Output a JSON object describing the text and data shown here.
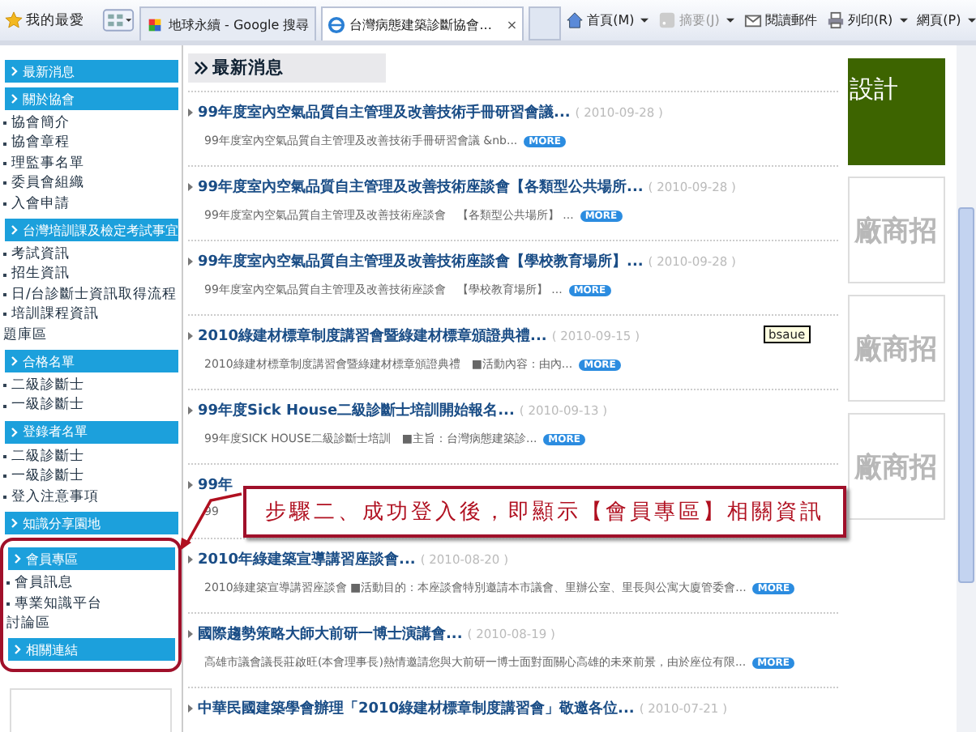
{
  "browser": {
    "favorites": "我的最愛",
    "tabs": [
      {
        "title": "地球永續 - Google 搜尋",
        "kind": "search",
        "selected": false
      },
      {
        "title": "台灣病態建築診斷協會...",
        "kind": "site",
        "selected": true,
        "close": "×"
      }
    ],
    "commands": [
      {
        "label": "首頁(M)",
        "kind": "home",
        "disabled": false,
        "dropdown": true
      },
      {
        "label": "摘要(J)",
        "kind": "feed",
        "disabled": true,
        "dropdown": true
      },
      {
        "label": "閱讀郵件",
        "kind": "mail",
        "disabled": false,
        "dropdown": false
      },
      {
        "label": "列印(R)",
        "kind": "print",
        "disabled": false,
        "dropdown": true
      },
      {
        "label": "網頁(P)",
        "kind": "page",
        "disabled": false,
        "dropdown": true
      }
    ]
  },
  "sidebar": {
    "sections": [
      {
        "heading": "最新消息",
        "highlighted": false
      },
      {
        "heading": "關於協會",
        "highlighted": false,
        "items": [
          {
            "label": "協會簡介",
            "bullet": true
          },
          {
            "label": "協會章程",
            "bullet": true
          },
          {
            "label": "理監事名單",
            "bullet": true
          },
          {
            "label": "委員會組織",
            "bullet": true
          },
          {
            "label": "入會申請",
            "bullet": true
          }
        ]
      },
      {
        "heading": "台灣培訓課及檢定考試事宜",
        "highlighted": false,
        "items": [
          {
            "label": "考試資訊",
            "bullet": true
          },
          {
            "label": "招生資訊",
            "bullet": true
          },
          {
            "label": "日/台診斷士資訊取得流程",
            "bullet": true
          },
          {
            "label": "培訓課程資訊",
            "bullet": true
          },
          {
            "label": "題庫區",
            "bullet": false
          }
        ]
      },
      {
        "heading": "合格名單",
        "highlighted": false,
        "items": [
          {
            "label": "二級診斷士",
            "bullet": true
          },
          {
            "label": "一級診斷士",
            "bullet": true
          }
        ]
      },
      {
        "heading": "登錄者名單",
        "highlighted": false,
        "items": [
          {
            "label": "二級診斷士",
            "bullet": true
          },
          {
            "label": "一級診斷士",
            "bullet": true
          },
          {
            "label": "登入注意事項",
            "bullet": true
          }
        ]
      },
      {
        "heading": "知識分享園地",
        "highlighted": false
      },
      {
        "heading": "會員專區",
        "highlighted": true,
        "items": [
          {
            "label": "會員訊息",
            "bullet": true
          },
          {
            "label": "專業知識平台",
            "bullet": true
          },
          {
            "label": "討論區",
            "bullet": false
          }
        ]
      },
      {
        "heading": "相關連結",
        "highlighted": true
      }
    ]
  },
  "news": {
    "heading": "最新消息",
    "items": [
      {
        "title": "99年度室內空氣品質自主管理及改善技術手冊研習會議...",
        "date": "( 2010-09-28 )",
        "summary": "99年度室內空氣品質自主管理及改善技術手冊研習會議 &nb...",
        "more": "MORE"
      },
      {
        "title": "99年度室內空氣品質自主管理及改善技術座談會【各類型公共場所...",
        "date": "( 2010-09-28 )",
        "summary": "99年度室內空氣品質自主管理及改善技術座談會　【各類型公共場所】 ...",
        "more": "MORE"
      },
      {
        "title": "99年度室內空氣品質自主管理及改善技術座談會【學校教育場所】...",
        "date": "( 2010-09-28 )",
        "summary": "99年度室內空氣品質自主管理及改善技術座談會　【學校教育場所】 ...",
        "more": "MORE"
      },
      {
        "title": "2010綠建材標章制度講習會暨綠建材標章頒證典禮...",
        "date": "( 2010-09-15 )",
        "summary": "2010綠建材標章制度講習會暨綠建材標章頒證典禮　■活動內容：由內...",
        "more": "MORE"
      },
      {
        "title": "99年度Sick House二級診斷士培訓開始報名...",
        "date": "( 2010-09-13 )",
        "summary": "99年度SICK HOUSE二級診斷士培訓　■主旨：台灣病態建築診...",
        "more": "MORE"
      },
      {
        "title": "99年",
        "summary": "99"
      },
      {
        "title": "2010年綠建築宣導講習座談會...",
        "date": "( 2010-08-20 )",
        "summary": "2010綠建築宣導講習座談會 ■活動目的：本座談會特別邀請本市議會、里辦公室、里長與公寓大廈管委會...",
        "more": "MORE"
      },
      {
        "title": "國際趨勢策略大師大前研一博士演講會...",
        "date": "( 2010-08-19 )",
        "summary": "高雄市議會議長莊啟旺(本會理事長)熱情邀請您與大前研一博士面對面關心高雄的未來前景，由於座位有限...",
        "more": "MORE"
      },
      {
        "title": "中華民國建築學會辦理「2010綠建材標章制度講習會」敬邀各位...",
        "date": "( 2010-07-21 )"
      }
    ],
    "tooltip": "bsaue"
  },
  "callout": "步驟二、成功登入後，即顯示【會員專區】相關資訊",
  "right_column": {
    "banner": "設計",
    "ads": [
      "廠商招",
      "廠商招",
      "廠商招"
    ]
  }
}
